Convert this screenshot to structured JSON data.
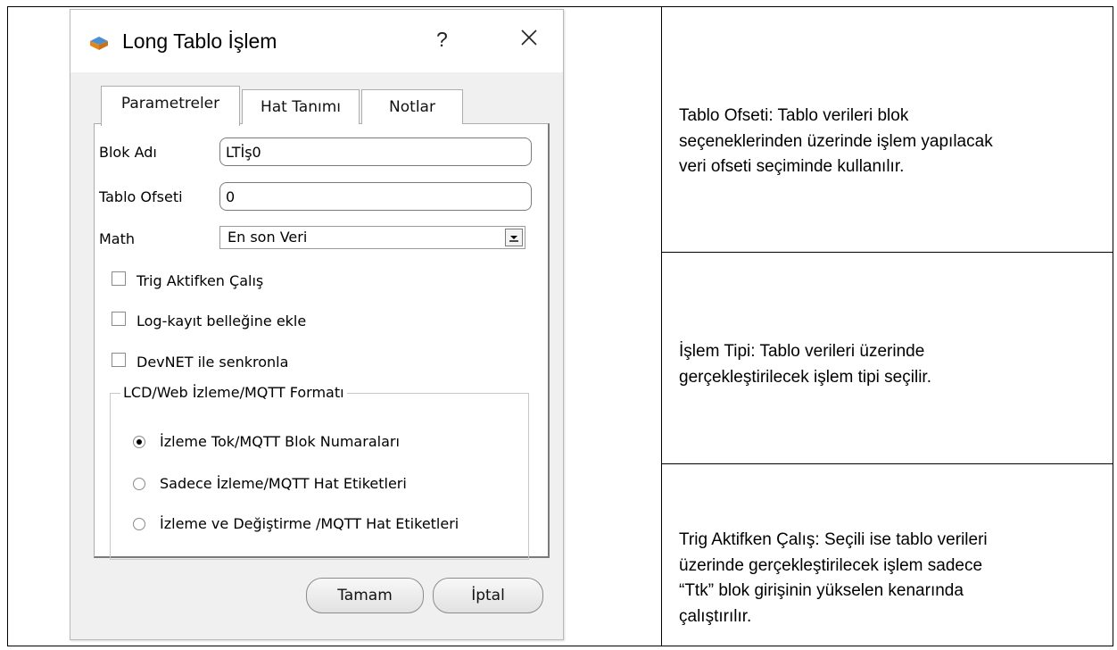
{
  "dialog": {
    "title": "Long Tablo İşlem",
    "help_label": "?",
    "tabs": [
      {
        "label": "Parametreler"
      },
      {
        "label": "Hat Tanımı"
      },
      {
        "label": "Notlar"
      }
    ],
    "fields": {
      "blok_adi": {
        "label": "Blok Adı",
        "value": "LTİş0"
      },
      "tablo_ofseti": {
        "label": "Tablo Ofseti",
        "value": "0"
      },
      "math": {
        "label": "Math",
        "value": "En son Veri"
      }
    },
    "checkboxes": [
      {
        "label": "Trig Aktifken Çalış",
        "checked": false
      },
      {
        "label": "Log-kayıt belleğine ekle",
        "checked": false
      },
      {
        "label": "DevNET ile senkronla",
        "checked": false
      }
    ],
    "group": {
      "title": "LCD/Web İzleme/MQTT Formatı",
      "options": [
        {
          "label": "İzleme Tok/MQTT Blok Numaraları",
          "selected": true
        },
        {
          "label": "Sadece İzleme/MQTT Hat Etiketleri",
          "selected": false
        },
        {
          "label": "İzleme ve Değiştirme /MQTT Hat Etiketleri",
          "selected": false
        }
      ]
    },
    "buttons": {
      "ok": "Tamam",
      "cancel": "İptal"
    }
  },
  "notes": {
    "tablo_ofseti": {
      "line1": "Tablo Ofseti:  Tablo verileri blok",
      "line2": "seçeneklerinden  üzerinde işlem yapılacak",
      "line3": "veri ofseti seçiminde kullanılır."
    },
    "islem_tipi": {
      "line1": "İşlem Tipi:  Tablo verileri üzerinde",
      "line2": "gerçekleştirilecek işlem tipi seçilir."
    },
    "trig": {
      "line1": "Trig Aktifken Çalış:  Seçili ise tablo verileri",
      "line2": "üzerinde gerçekleştirilecek işlem sadece",
      "line3": "“Ttk” blok girişinin yükselen kenarında",
      "line4": "çalıştırılır."
    }
  }
}
